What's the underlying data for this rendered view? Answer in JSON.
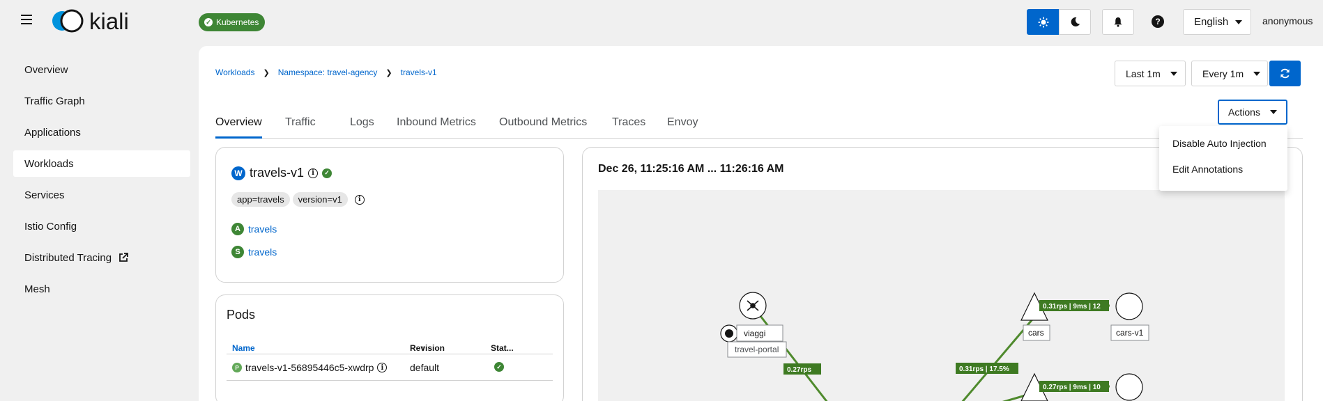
{
  "app": {
    "name": "kiali",
    "cluster_badge": "Kubernetes",
    "user": "anonymous"
  },
  "masthead": {
    "language": "English"
  },
  "sidebar": {
    "items": [
      {
        "label": "Overview"
      },
      {
        "label": "Traffic Graph"
      },
      {
        "label": "Applications"
      },
      {
        "label": "Workloads",
        "active": true
      },
      {
        "label": "Services"
      },
      {
        "label": "Istio Config"
      },
      {
        "label": "Distributed Tracing",
        "external": true
      },
      {
        "label": "Mesh"
      }
    ]
  },
  "breadcrumb": [
    "Workloads",
    "Namespace: travel-agency",
    "travels-v1"
  ],
  "toolbar": {
    "time_range": "Last 1m",
    "refresh_interval": "Every 1m"
  },
  "tabs": [
    {
      "label": "Overview",
      "active": true
    },
    {
      "label": "Traffic"
    },
    {
      "label": "Logs"
    },
    {
      "label": "Inbound Metrics"
    },
    {
      "label": "Outbound Metrics"
    },
    {
      "label": "Traces"
    },
    {
      "label": "Envoy"
    }
  ],
  "actions": {
    "label": "Actions",
    "menu": [
      "Disable Auto Injection",
      "Edit Annotations"
    ]
  },
  "workload": {
    "badge": "W",
    "name": "travels-v1",
    "labels": [
      "app=travels",
      "version=v1"
    ],
    "app": {
      "badge": "A",
      "name": "travels"
    },
    "service": {
      "badge": "S",
      "name": "travels"
    }
  },
  "pods": {
    "title": "Pods",
    "columns": [
      "Name",
      "Revision",
      "Stat..."
    ],
    "rows": [
      {
        "badge": "P",
        "name": "travels-v1-56895446c5-xwdrp",
        "revision": "default"
      }
    ]
  },
  "graph": {
    "time_range": "Dec 26, 11:25:16 AM ... 11:26:16 AM",
    "nodes": [
      "viaggi",
      "travel-portal",
      "cars",
      "cars-v1"
    ],
    "edge_labels": [
      "0.27rps",
      "0.31rps | 17.5%",
      "0.31rps | 9ms | 12",
      "0.27rps | 9ms | 10"
    ]
  },
  "colors": {
    "accent": "#0066cc",
    "success": "#3e8635",
    "edge": "#4f8a2d"
  }
}
